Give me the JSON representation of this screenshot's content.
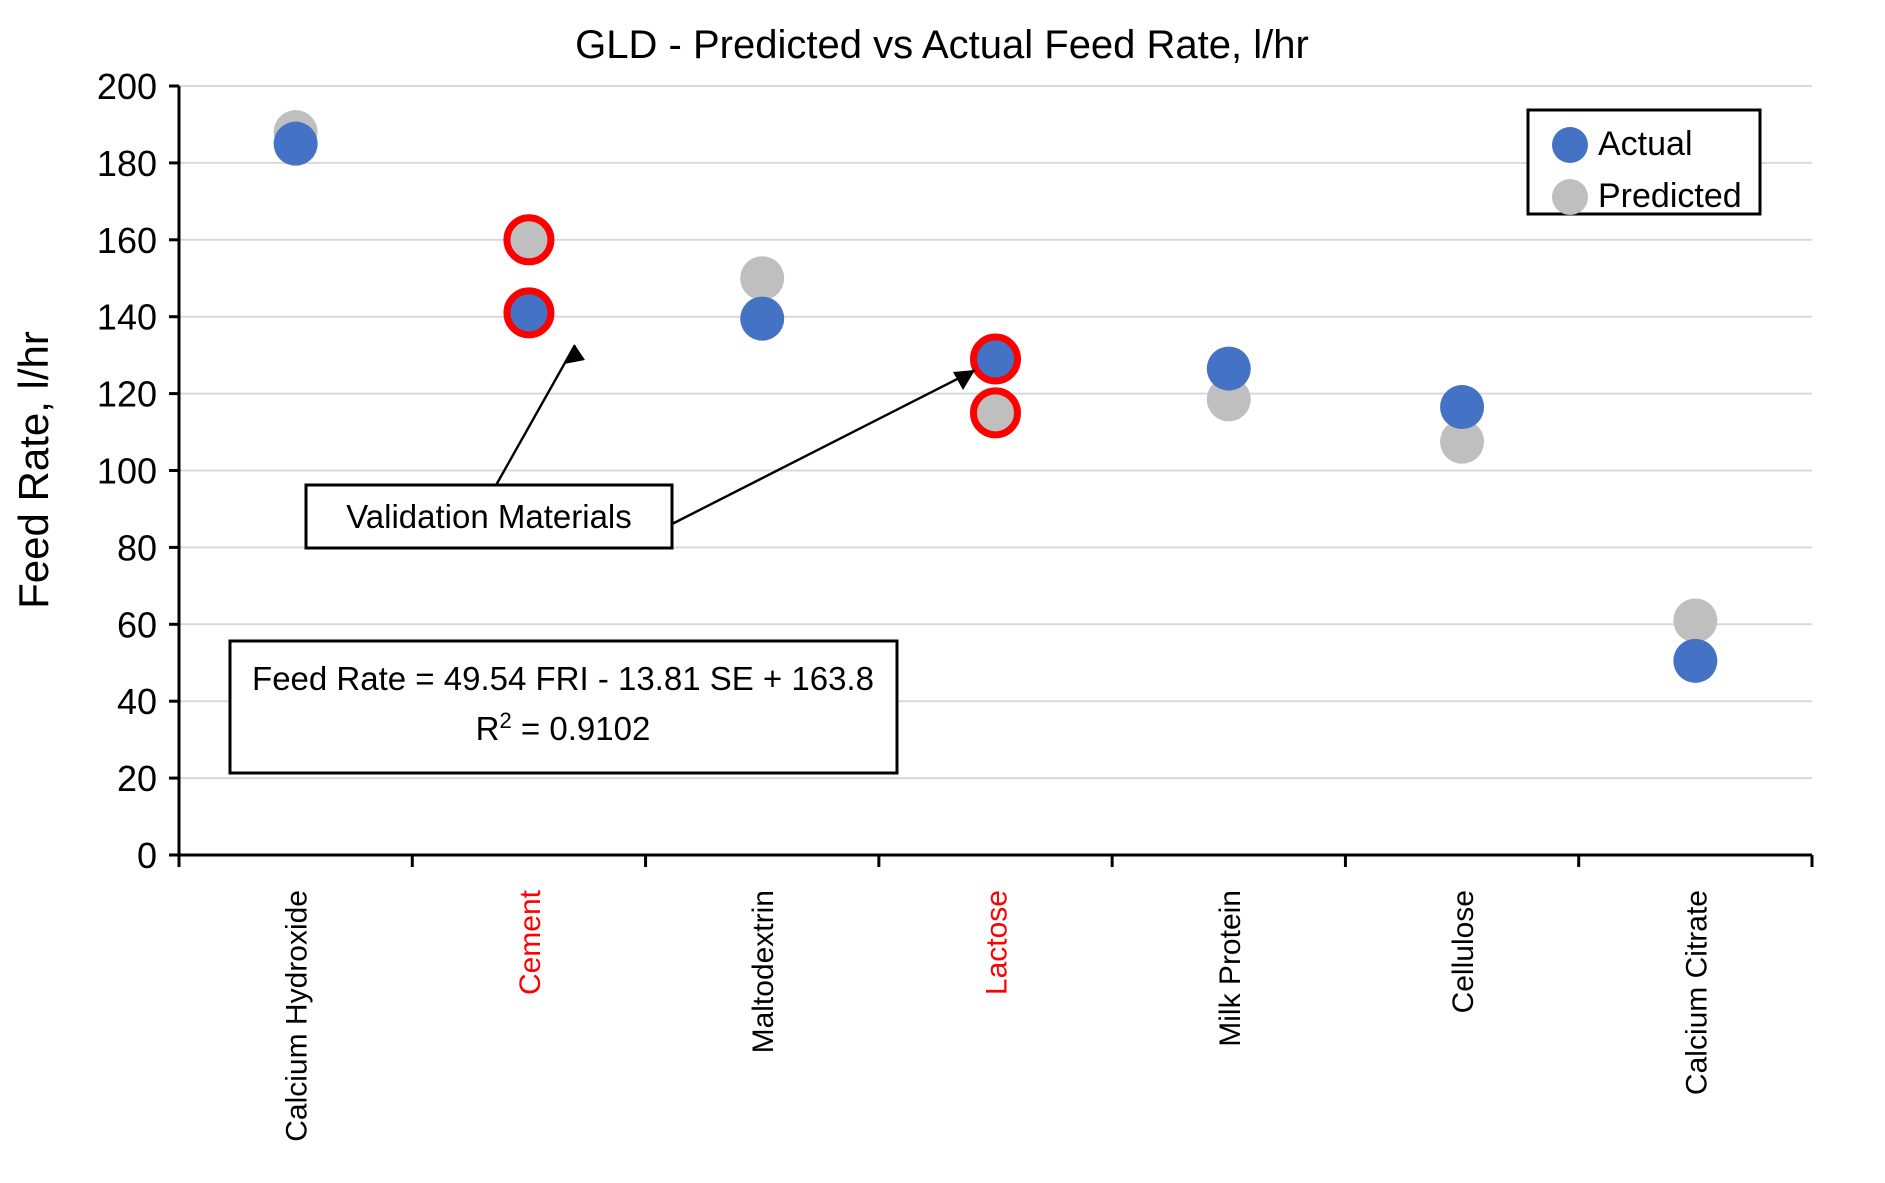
{
  "chart_data": {
    "type": "scatter",
    "title": "GLD - Predicted vs Actual Feed Rate, l/hr",
    "xlabel": "",
    "ylabel": "Feed Rate, l/hr",
    "ylim": [
      0,
      200
    ],
    "ytick_step": 20,
    "yticks": [
      "0",
      "20",
      "40",
      "60",
      "80",
      "100",
      "120",
      "140",
      "160",
      "180",
      "200"
    ],
    "grid": true,
    "legend_position": "top-right",
    "categories": [
      "Calcium Hydroxide",
      "Cement",
      "Maltodextrin",
      "Lactose",
      "Milk Protein",
      "Cellulose",
      "Calcium Citrate"
    ],
    "validation_categories": [
      "Cement",
      "Lactose"
    ],
    "series": [
      {
        "name": "Actual",
        "color": "#4472C4",
        "values": [
          185,
          141,
          139.5,
          129,
          126.5,
          116.5,
          50.5
        ]
      },
      {
        "name": "Predicted",
        "color": "#BFBFBF",
        "values": [
          188,
          160,
          150,
          115,
          118.5,
          107.5,
          61
        ]
      }
    ],
    "highlight_color": "#FF0000",
    "annotations": [
      {
        "text": "Validation Materials",
        "points_to": [
          "Cement Actual",
          "Lactose Actual"
        ]
      }
    ],
    "equation_box": {
      "line1": "Feed Rate = 49.54 FRI - 13.81 SE + 163.8",
      "line2_prefix": "R",
      "line2_sup": "2",
      "line2_suffix": " = 0.9102"
    }
  },
  "legend": {
    "items": [
      {
        "label": "Actual",
        "color": "#4472C4"
      },
      {
        "label": "Predicted",
        "color": "#BFBFBF"
      }
    ]
  }
}
